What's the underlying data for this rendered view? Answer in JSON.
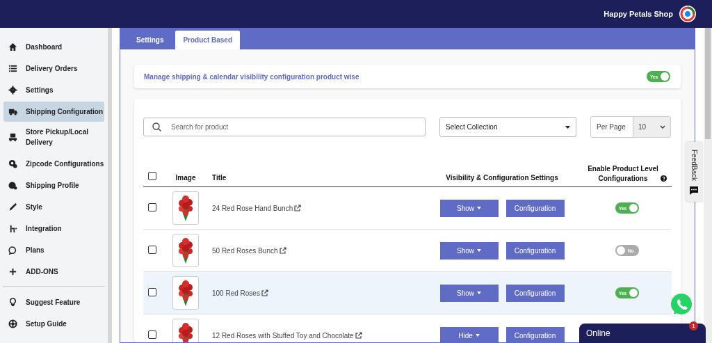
{
  "shop": {
    "name": "Happy Petals Shop"
  },
  "sidebar": {
    "items": [
      {
        "label": "Dashboard",
        "selected": false
      },
      {
        "label": "Delivery Orders",
        "selected": false
      },
      {
        "label": "Settings",
        "selected": false
      },
      {
        "label": "Shipping Configuration",
        "selected": true
      },
      {
        "label": "Store Pickup/Local Delivery",
        "selected": false
      },
      {
        "label": "Zipcode Configurations",
        "selected": false
      },
      {
        "label": "Shipping Profile",
        "selected": false
      },
      {
        "label": "Style",
        "selected": false
      },
      {
        "label": "Integration",
        "selected": false
      },
      {
        "label": "Plans",
        "selected": false
      },
      {
        "label": "ADD-ONS",
        "selected": false
      }
    ],
    "footer_items": [
      {
        "label": "Suggest Feature",
        "selected": false
      },
      {
        "label": "Setup Guide",
        "selected": false
      }
    ]
  },
  "tabs": [
    {
      "label": "Settings",
      "selected": false
    },
    {
      "label": "Product Based",
      "selected": true
    }
  ],
  "banner": {
    "text": "Manage shipping & calendar visibility configuration product wise",
    "toggle": {
      "label": "Yes",
      "on": true
    }
  },
  "search": {
    "placeholder": "Search for product"
  },
  "collection": {
    "value": "Select Collection"
  },
  "per_page": {
    "label": "Per Page",
    "value": "10"
  },
  "table": {
    "columns": [
      "Image",
      "Title",
      "Visibility & Configuration Settings",
      "Enable Product Level Configurations"
    ],
    "select_all_checked": false,
    "rows": [
      {
        "checked": false,
        "highlighted": false,
        "title": "24 Red Rose Hand Bunch",
        "visibility": "Show",
        "action": "Configuration",
        "enabled": true,
        "toggle_label": "Yes"
      },
      {
        "checked": false,
        "highlighted": false,
        "title": "50 Red Roses Bunch",
        "visibility": "Show",
        "action": "Configuration",
        "enabled": false,
        "toggle_label": "No"
      },
      {
        "checked": false,
        "highlighted": true,
        "title": "100 Red Roses",
        "visibility": "Show",
        "action": "Configuration",
        "enabled": true,
        "toggle_label": "Yes"
      },
      {
        "checked": false,
        "highlighted": false,
        "title": "12 Red Roses with Stuffed Toy and Chocolate",
        "visibility": "Hide",
        "action": "Configuration"
      }
    ]
  },
  "feedback": {
    "label": "FeedBack"
  },
  "chat": {
    "status": "Online",
    "badge": "1"
  }
}
